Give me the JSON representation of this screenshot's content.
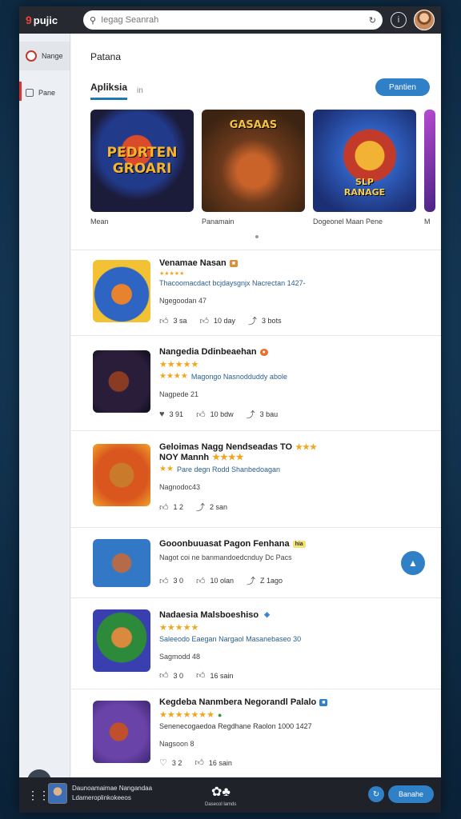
{
  "app": {
    "brand_mark": "9",
    "brand_name": "pujic"
  },
  "search": {
    "placeholder": "Iegag Seanrah"
  },
  "topbar_icons": [
    "refresh-icon",
    "info-icon"
  ],
  "sidebar": {
    "items": [
      {
        "label": "Nange",
        "icon": "home-icon"
      },
      {
        "label": "Pane",
        "icon": "square-icon"
      }
    ]
  },
  "main": {
    "page_title": "Patana",
    "tabs": [
      {
        "label": "Apliksia",
        "active": true
      },
      {
        "label": "in",
        "active": false
      }
    ],
    "primary_button": "Pantien"
  },
  "featured": [
    {
      "art_title": "PEDRTEN\nGROARI",
      "label": "Mean"
    },
    {
      "art_title": "GASAAS",
      "label": "Panamain"
    },
    {
      "art_title": "SLP\nRANAGE",
      "label": "Dogeonel Maan Pene"
    },
    {
      "art_title": "",
      "label": "M"
    }
  ],
  "apps": [
    {
      "title": "Venamae Nasan",
      "badge": "",
      "stars": "",
      "subtitle": "Thacoomacdact bcjdaysgnjx Nacrectan 1427-",
      "meta": "Ngegoodan 47",
      "actions": [
        "3 sa",
        "10 day",
        "3 bots"
      ]
    },
    {
      "title": "Nangedia Ddinbeaehan",
      "badge": "",
      "stars": "★★★★★",
      "subtitle": "Magongo Nasnodduddy abole",
      "meta": "Nagpede 21",
      "actions": [
        "3 91",
        "10 bdw",
        "3 bau"
      ]
    },
    {
      "title": "Geloimas Nagg Nendseadas TO",
      "title2": "NOY Mannh",
      "badge": "",
      "stars": "★★★★",
      "subtitle": "Pare degn Rodd Shanbedoagan",
      "meta": "Nagnodoc43",
      "actions": [
        "1 2",
        "2 san"
      ]
    },
    {
      "title": "Gooonbuuasat Pagon Fenhana",
      "badge": "hia",
      "stars": "",
      "subtitle": "Nagot coi ne banmandoedcnduy Dc Pacs",
      "meta": "",
      "actions": [
        "3 0",
        "10 olan",
        "Z 1ago"
      ]
    },
    {
      "title": "Nadaesia Malsboeshiso",
      "badge": "",
      "stars": "★★★★★",
      "subtitle": "Saleeodo Eaegan Nargaol Masanebaseo 30",
      "meta": "Sagmodd 48",
      "actions": [
        "3 0",
        "16 sain"
      ]
    },
    {
      "title": "Kegdeba Nanmbera Negorandl Palalo",
      "badge": "",
      "stars": "★★★★★★★",
      "subtitle": "Senenecogaedoa Regdhane Raolon 1000 1427",
      "meta": "Nagsoon 8",
      "actions": [
        "3 2",
        "16 sain"
      ]
    }
  ],
  "bottombar": {
    "mini_line1": "Daunoamaimae Nangandaa",
    "mini_line2": "Ldameroplinkokeeos",
    "center_label": "Dasecol lamds",
    "button": "Banahe"
  },
  "colors": {
    "accent": "#2f80c6",
    "star": "#f2a51f",
    "topbar": "#262a30"
  }
}
